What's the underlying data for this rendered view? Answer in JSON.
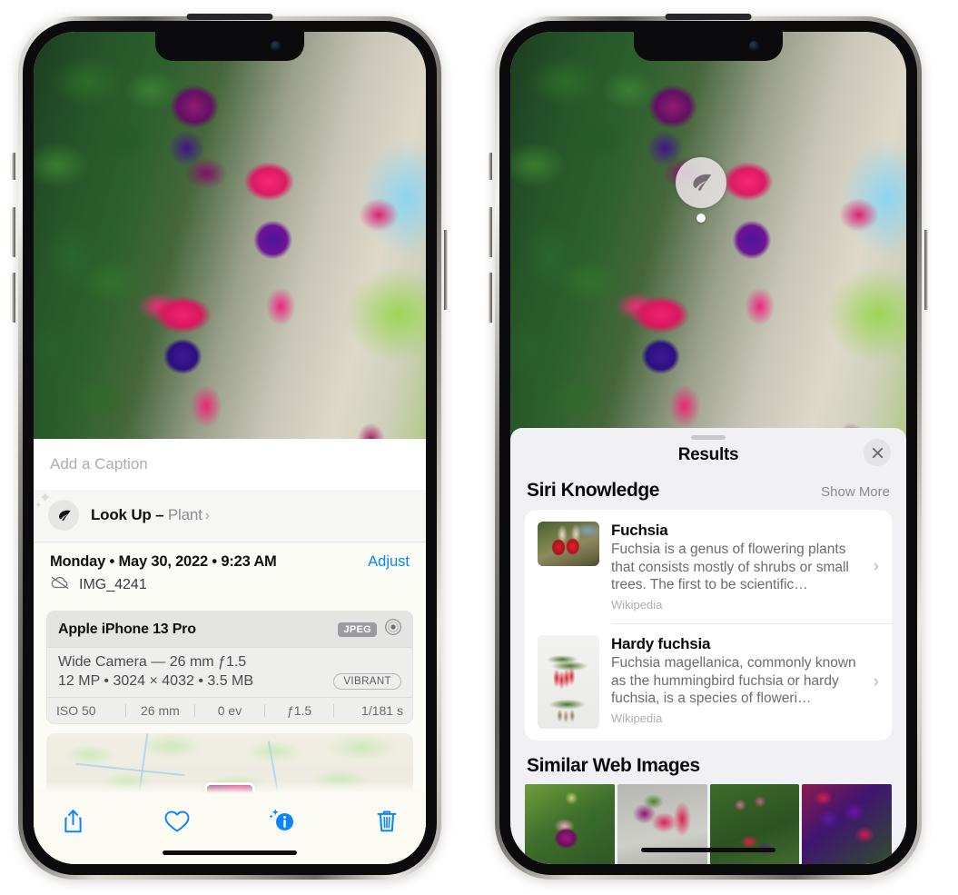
{
  "left_phone": {
    "caption_placeholder": "Add a Caption",
    "lookup": {
      "label": "Look Up – ",
      "subject": "Plant",
      "chevron": "›",
      "icon": "leaf-icon"
    },
    "meta": {
      "date": "Monday • May 30, 2022 • 9:23 AM",
      "adjust_label": "Adjust",
      "filename": "IMG_4241",
      "cloud_icon": "icloud-slash-icon"
    },
    "exif": {
      "device": "Apple iPhone 13 Pro",
      "format_tag": "JPEG",
      "raw_icon": "aperture-icon",
      "lens": "Wide Camera — 26 mm ƒ1.5",
      "size_line": "12 MP • 3024 × 4032 • 3.5 MB",
      "style_tag": "VIBRANT",
      "stats": [
        "ISO 50",
        "26 mm",
        "0 ev",
        "ƒ1.5",
        "1/181 s"
      ]
    },
    "toolbar": {
      "share_label": "share-icon",
      "favorite_label": "heart-icon",
      "info_label": "info-sparkle-icon",
      "delete_label": "trash-icon"
    }
  },
  "right_phone": {
    "visual_lookup_badge": "leaf-icon",
    "results": {
      "title": "Results",
      "close_label": "×",
      "siri_section": {
        "title": "Siri Knowledge",
        "show_more": "Show More",
        "items": [
          {
            "title": "Fuchsia",
            "description": "Fuchsia is a genus of flowering plants that consists mostly of shrubs or small trees. The first to be scientific…",
            "source": "Wikipedia",
            "chevron": "›"
          },
          {
            "title": "Hardy fuchsia",
            "description": "Fuchsia magellanica, commonly known as the hummingbird fuchsia or hardy fuchsia, is a species of floweri…",
            "source": "Wikipedia",
            "chevron": "›"
          }
        ]
      },
      "similar_section": {
        "title": "Similar Web Images",
        "images": [
          "fuchsia-web-image-1",
          "fuchsia-web-image-2",
          "fuchsia-web-image-3",
          "fuchsia-web-image-4"
        ]
      }
    }
  },
  "colors": {
    "accent_blue": "#0a84ff",
    "sheet_bg": "#f1f1f5",
    "card_bg": "#ffffff",
    "muted_text": "#8a8a8f"
  }
}
